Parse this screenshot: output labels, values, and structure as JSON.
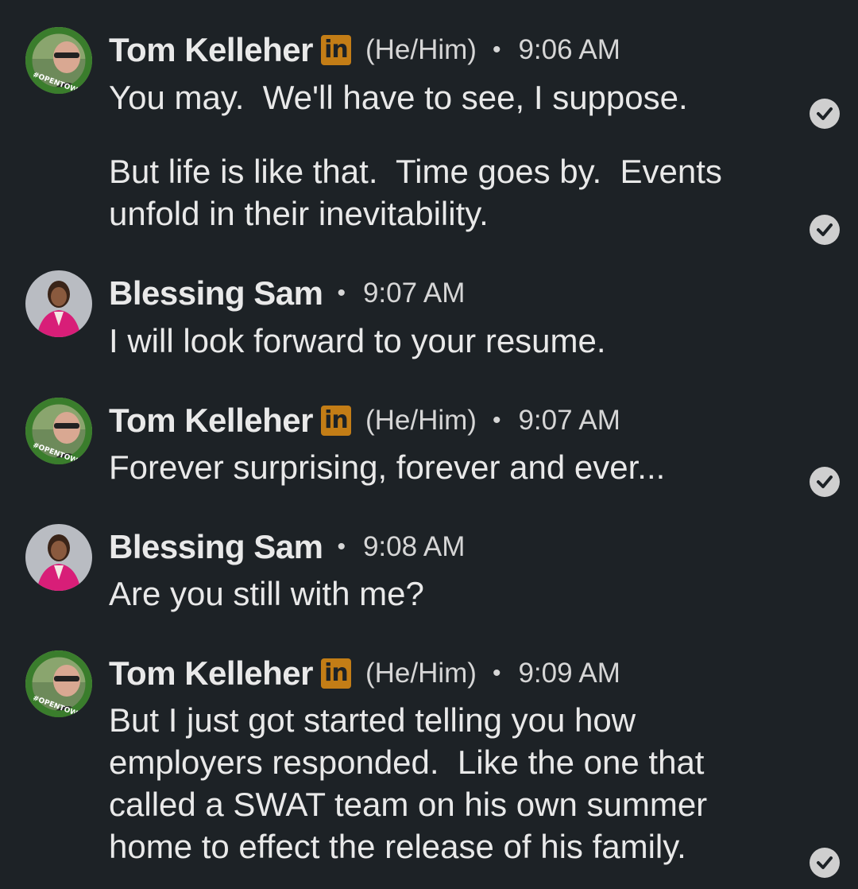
{
  "messages": [
    {
      "sender": "Tom Kelleher",
      "linkedin_badge": "in",
      "pronouns": "(He/Him)",
      "separator": "•",
      "time": "9:06 AM",
      "avatar_ring_text": "#OPENTOWORK",
      "paragraphs": [
        "You may.  We'll have to see, I suppose.",
        "But life is like that.  Time goes by.  Events unfold in their inevitability."
      ]
    },
    {
      "sender": "Blessing Sam",
      "separator": "•",
      "time": "9:07 AM",
      "paragraphs": [
        "I will look forward to your resume."
      ]
    },
    {
      "sender": "Tom Kelleher",
      "linkedin_badge": "in",
      "pronouns": "(He/Him)",
      "separator": "•",
      "time": "9:07 AM",
      "avatar_ring_text": "#OPENTOWORK",
      "paragraphs": [
        "Forever surprising, forever and ever..."
      ]
    },
    {
      "sender": "Blessing Sam",
      "separator": "•",
      "time": "9:08 AM",
      "paragraphs": [
        "Are you still with me?"
      ]
    },
    {
      "sender": "Tom Kelleher",
      "linkedin_badge": "in",
      "pronouns": "(He/Him)",
      "separator": "•",
      "time": "9:09 AM",
      "avatar_ring_text": "#OPENTOWORK",
      "paragraphs": [
        "But I just got started telling you how employers responded.  Like the one that called a SWAT team on his own summer home to effect the release of his family."
      ]
    }
  ],
  "icons": {
    "read_receipt": "check-circle-icon",
    "linkedin": "linkedin-badge-icon"
  },
  "colors": {
    "background": "#1d2226",
    "text": "#e9e9e9",
    "linkedin_badge": "#c37d16",
    "open_to_work_ring": "#3a7d2c",
    "receipt": "#cfcfcf"
  }
}
